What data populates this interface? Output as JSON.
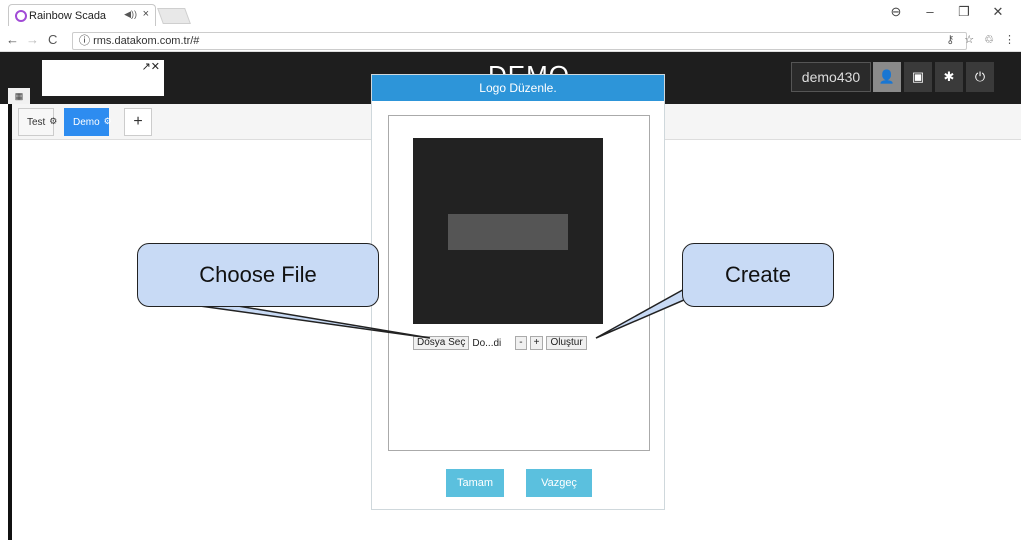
{
  "browser": {
    "tab_title": "Rainbow Scada",
    "tab_audio": "◀))",
    "tab_close": "×",
    "url": "rms.datakom.com.tr/#",
    "window_controls": [
      "⊖",
      "–",
      "❐",
      "✕"
    ]
  },
  "header": {
    "title": "DEMO",
    "logo_tools": "↗✕",
    "user": "demo430"
  },
  "tabs": [
    {
      "label": "Test"
    },
    {
      "label": "Demo"
    }
  ],
  "add_tab_label": "+",
  "modal": {
    "title": "Logo Düzenle.",
    "choose_file": "Dosya Seç",
    "file_name": "Do...di",
    "minus": "-",
    "plus": "+",
    "create": "Oluştur",
    "ok": "Tamam",
    "cancel": "Vazgeç"
  },
  "callouts": {
    "choose_file": "Choose File",
    "create": "Create"
  },
  "colors": {
    "modal_header": "#2d95d9",
    "footer_buttons": "#5bc0de",
    "callout_fill": "#c8daf5"
  }
}
